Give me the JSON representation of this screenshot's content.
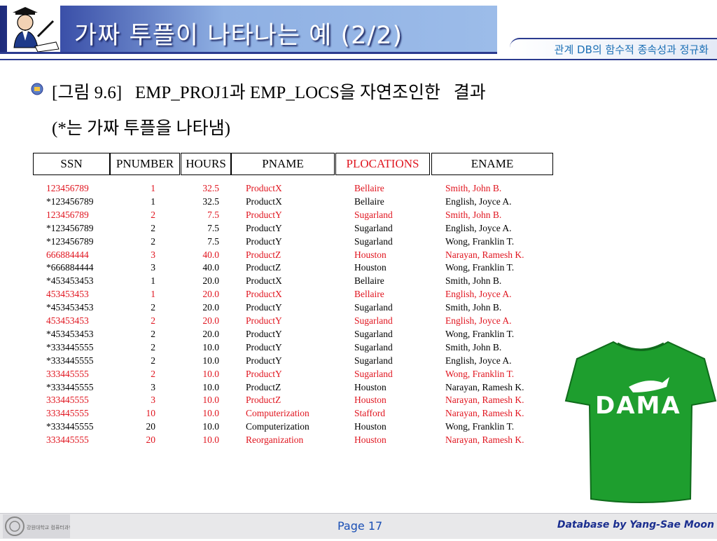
{
  "header": {
    "title": "가짜 투플이 나타나는 예 (2/2)",
    "subtitle": "관계 DB의 함수적 종속성과 정규화"
  },
  "caption": {
    "line1": "[그림 9.6]   EMP_PROJ1과 EMP_LOCS을 자연조인한   결과",
    "line2": "(*는 가짜 투플을 나타냄)"
  },
  "table": {
    "columns": [
      "SSN",
      "PNUMBER",
      "HOURS",
      "PNAME",
      "PLOCATIONS",
      "ENAME"
    ],
    "rows": [
      {
        "ssn": "123456789",
        "pnumber": "1",
        "hours": "32.5",
        "pname": "ProductX",
        "ploc": "Bellaire",
        "ename": "Smith, John B.",
        "color": "#e0141e"
      },
      {
        "ssn": "*123456789",
        "pnumber": "1",
        "hours": "32.5",
        "pname": "ProductX",
        "ploc": "Bellaire",
        "ename": "English, Joyce A.",
        "color": "#000000"
      },
      {
        "ssn": "123456789",
        "pnumber": "2",
        "hours": "7.5",
        "pname": "ProductY",
        "ploc": "Sugarland",
        "ename": "Smith, John B.",
        "color": "#e0141e"
      },
      {
        "ssn": "*123456789",
        "pnumber": "2",
        "hours": "7.5",
        "pname": "ProductY",
        "ploc": "Sugarland",
        "ename": "English, Joyce A.",
        "color": "#000000"
      },
      {
        "ssn": "*123456789",
        "pnumber": "2",
        "hours": "7.5",
        "pname": "ProductY",
        "ploc": "Sugarland",
        "ename": "Wong, Franklin T.",
        "color": "#000000"
      },
      {
        "ssn": "666884444",
        "pnumber": "3",
        "hours": "40.0",
        "pname": "ProductZ",
        "ploc": "Houston",
        "ename": "Narayan, Ramesh K.",
        "color": "#e0141e"
      },
      {
        "ssn": "*666884444",
        "pnumber": "3",
        "hours": "40.0",
        "pname": "ProductZ",
        "ploc": "Houston",
        "ename": "Wong, Franklin T.",
        "color": "#000000"
      },
      {
        "ssn": "*453453453",
        "pnumber": "1",
        "hours": "20.0",
        "pname": "ProductX",
        "ploc": "Bellaire",
        "ename": "Smith, John B.",
        "color": "#000000"
      },
      {
        "ssn": "453453453",
        "pnumber": "1",
        "hours": "20.0",
        "pname": "ProductX",
        "ploc": "Bellaire",
        "ename": "English, Joyce A.",
        "color": "#e0141e"
      },
      {
        "ssn": "*453453453",
        "pnumber": "2",
        "hours": "20.0",
        "pname": "ProductY",
        "ploc": "Sugarland",
        "ename": "Smith, John B.",
        "color": "#000000"
      },
      {
        "ssn": "453453453",
        "pnumber": "2",
        "hours": "20.0",
        "pname": "ProductY",
        "ploc": "Sugarland",
        "ename": "English, Joyce A.",
        "color": "#e0141e"
      },
      {
        "ssn": "*453453453",
        "pnumber": "2",
        "hours": "20.0",
        "pname": "ProductY",
        "ploc": "Sugarland",
        "ename": "Wong, Franklin T.",
        "color": "#000000"
      },
      {
        "ssn": "*333445555",
        "pnumber": "2",
        "hours": "10.0",
        "pname": "ProductY",
        "ploc": "Sugarland",
        "ename": "Smith, John B.",
        "color": "#000000"
      },
      {
        "ssn": "*333445555",
        "pnumber": "2",
        "hours": "10.0",
        "pname": "ProductY",
        "ploc": "Sugarland",
        "ename": "English, Joyce A.",
        "color": "#000000"
      },
      {
        "ssn": "333445555",
        "pnumber": "2",
        "hours": "10.0",
        "pname": "ProductY",
        "ploc": "Sugarland",
        "ename": "Wong, Franklin T.",
        "color": "#e0141e"
      },
      {
        "ssn": "*333445555",
        "pnumber": "3",
        "hours": "10.0",
        "pname": "ProductZ",
        "ploc": "Houston",
        "ename": "Narayan, Ramesh K.",
        "color": "#000000"
      },
      {
        "ssn": "333445555",
        "pnumber": "3",
        "hours": "10.0",
        "pname": "ProductZ",
        "ploc": "Houston",
        "ename": "Narayan, Ramesh K.",
        "color": "#e0141e"
      },
      {
        "ssn": "333445555",
        "pnumber": "10",
        "hours": "10.0",
        "pname": "Computerization",
        "ploc": "Stafford",
        "ename": "Narayan, Ramesh K.",
        "color": "#e0141e"
      },
      {
        "ssn": "*333445555",
        "pnumber": "20",
        "hours": "10.0",
        "pname": "Computerization",
        "ploc": "Houston",
        "ename": "Wong, Franklin T.",
        "color": "#000000"
      },
      {
        "ssn": "333445555",
        "pnumber": "20",
        "hours": "10.0",
        "pname": "Reorganization",
        "ploc": "Houston",
        "ename": "Narayan, Ramesh K.",
        "color": "#e0141e"
      }
    ]
  },
  "illustration": {
    "shirt_text": "DAMA",
    "shirt_color": "#1e9e2e"
  },
  "footer": {
    "page": "Page 17",
    "credit": "Database by Yang-Sae Moon",
    "logo_text": "강원대학교 컴퓨터과학과"
  },
  "colors": {
    "title_band": "#9cbce9",
    "real_tuple": "#e0141e",
    "spurious_tuple": "#000000",
    "plocations_header": "#e0141e"
  }
}
